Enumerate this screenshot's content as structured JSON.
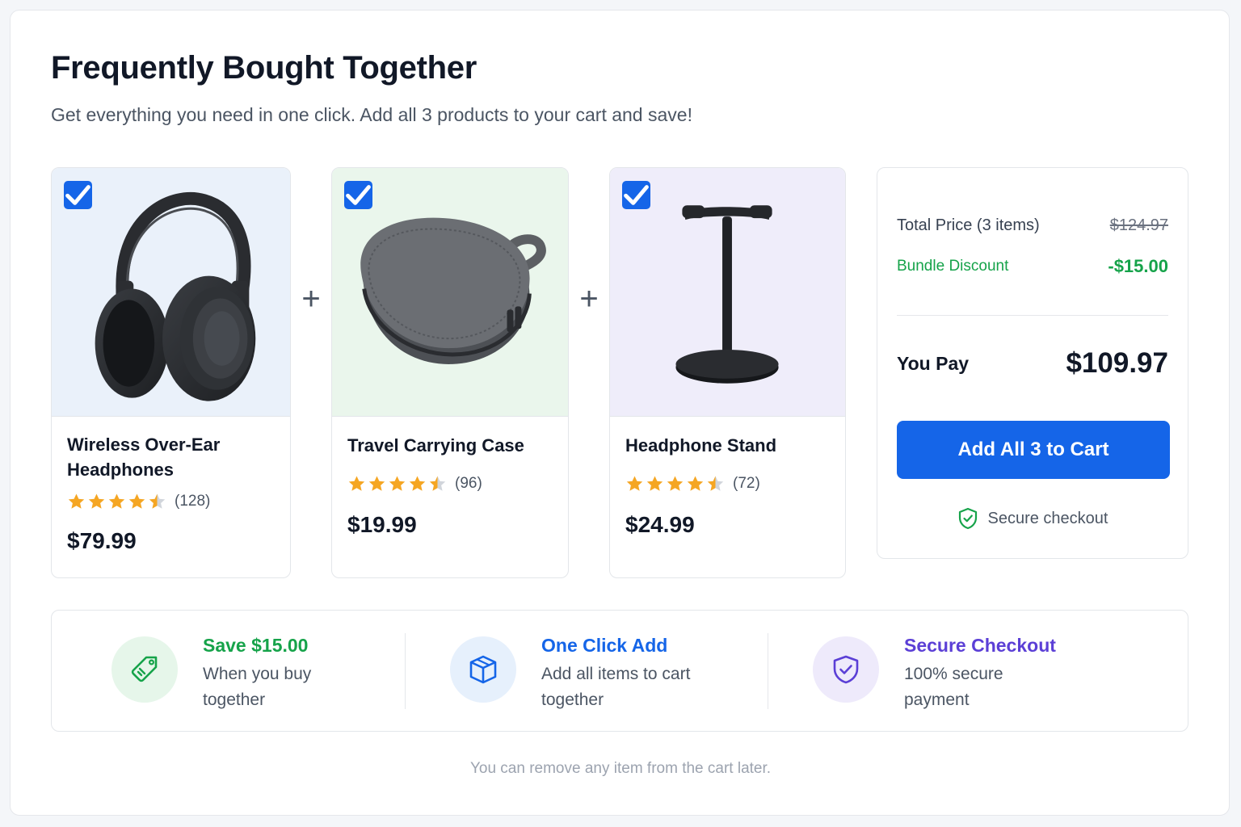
{
  "header": {
    "title": "Frequently Bought Together",
    "subtitle": "Get everything you need in one click. Add all 3 products to your cart and save!"
  },
  "products": [
    {
      "name": "Wireless Over-Ear Headphones",
      "rating": 4.5,
      "rating_count": "(128)",
      "price": "$79.99",
      "checked": true,
      "image_bg": "#eaf1fa"
    },
    {
      "name": "Travel Carrying Case",
      "rating": 4.5,
      "rating_count": "(96)",
      "price": "$19.99",
      "checked": true,
      "image_bg": "#eaf6ec"
    },
    {
      "name": "Headphone Stand",
      "rating": 4.5,
      "rating_count": "(72)",
      "price": "$24.99",
      "checked": true,
      "image_bg": "#efedfa"
    }
  ],
  "plus_symbol": "+",
  "summary": {
    "total_label": "Total Price (3 items)",
    "total_value": "$124.97",
    "discount_label": "Bundle Discount",
    "discount_value": "-$15.00",
    "pay_label": "You Pay",
    "pay_value": "$109.97",
    "cta_label": "Add All 3 to Cart",
    "secure_label": "Secure checkout"
  },
  "benefits": [
    {
      "title": "Save $15.00",
      "description": "When you buy together",
      "icon": "tag-icon",
      "color": "#16a34a",
      "bg": "#e6f6ea"
    },
    {
      "title": "One Click Add",
      "description": "Add all items to cart together",
      "icon": "box-icon",
      "color": "#1565e8",
      "bg": "#e6f0fc"
    },
    {
      "title": "Secure Checkout",
      "description": "100% secure payment",
      "icon": "shield-check-icon",
      "color": "#5b3fd6",
      "bg": "#eeeafb"
    }
  ],
  "footnote": "You can remove any item from the cart later.",
  "colors": {
    "accent": "#1565e8",
    "success": "#16a34a",
    "star": "#f5a623",
    "purple": "#5b3fd6"
  }
}
